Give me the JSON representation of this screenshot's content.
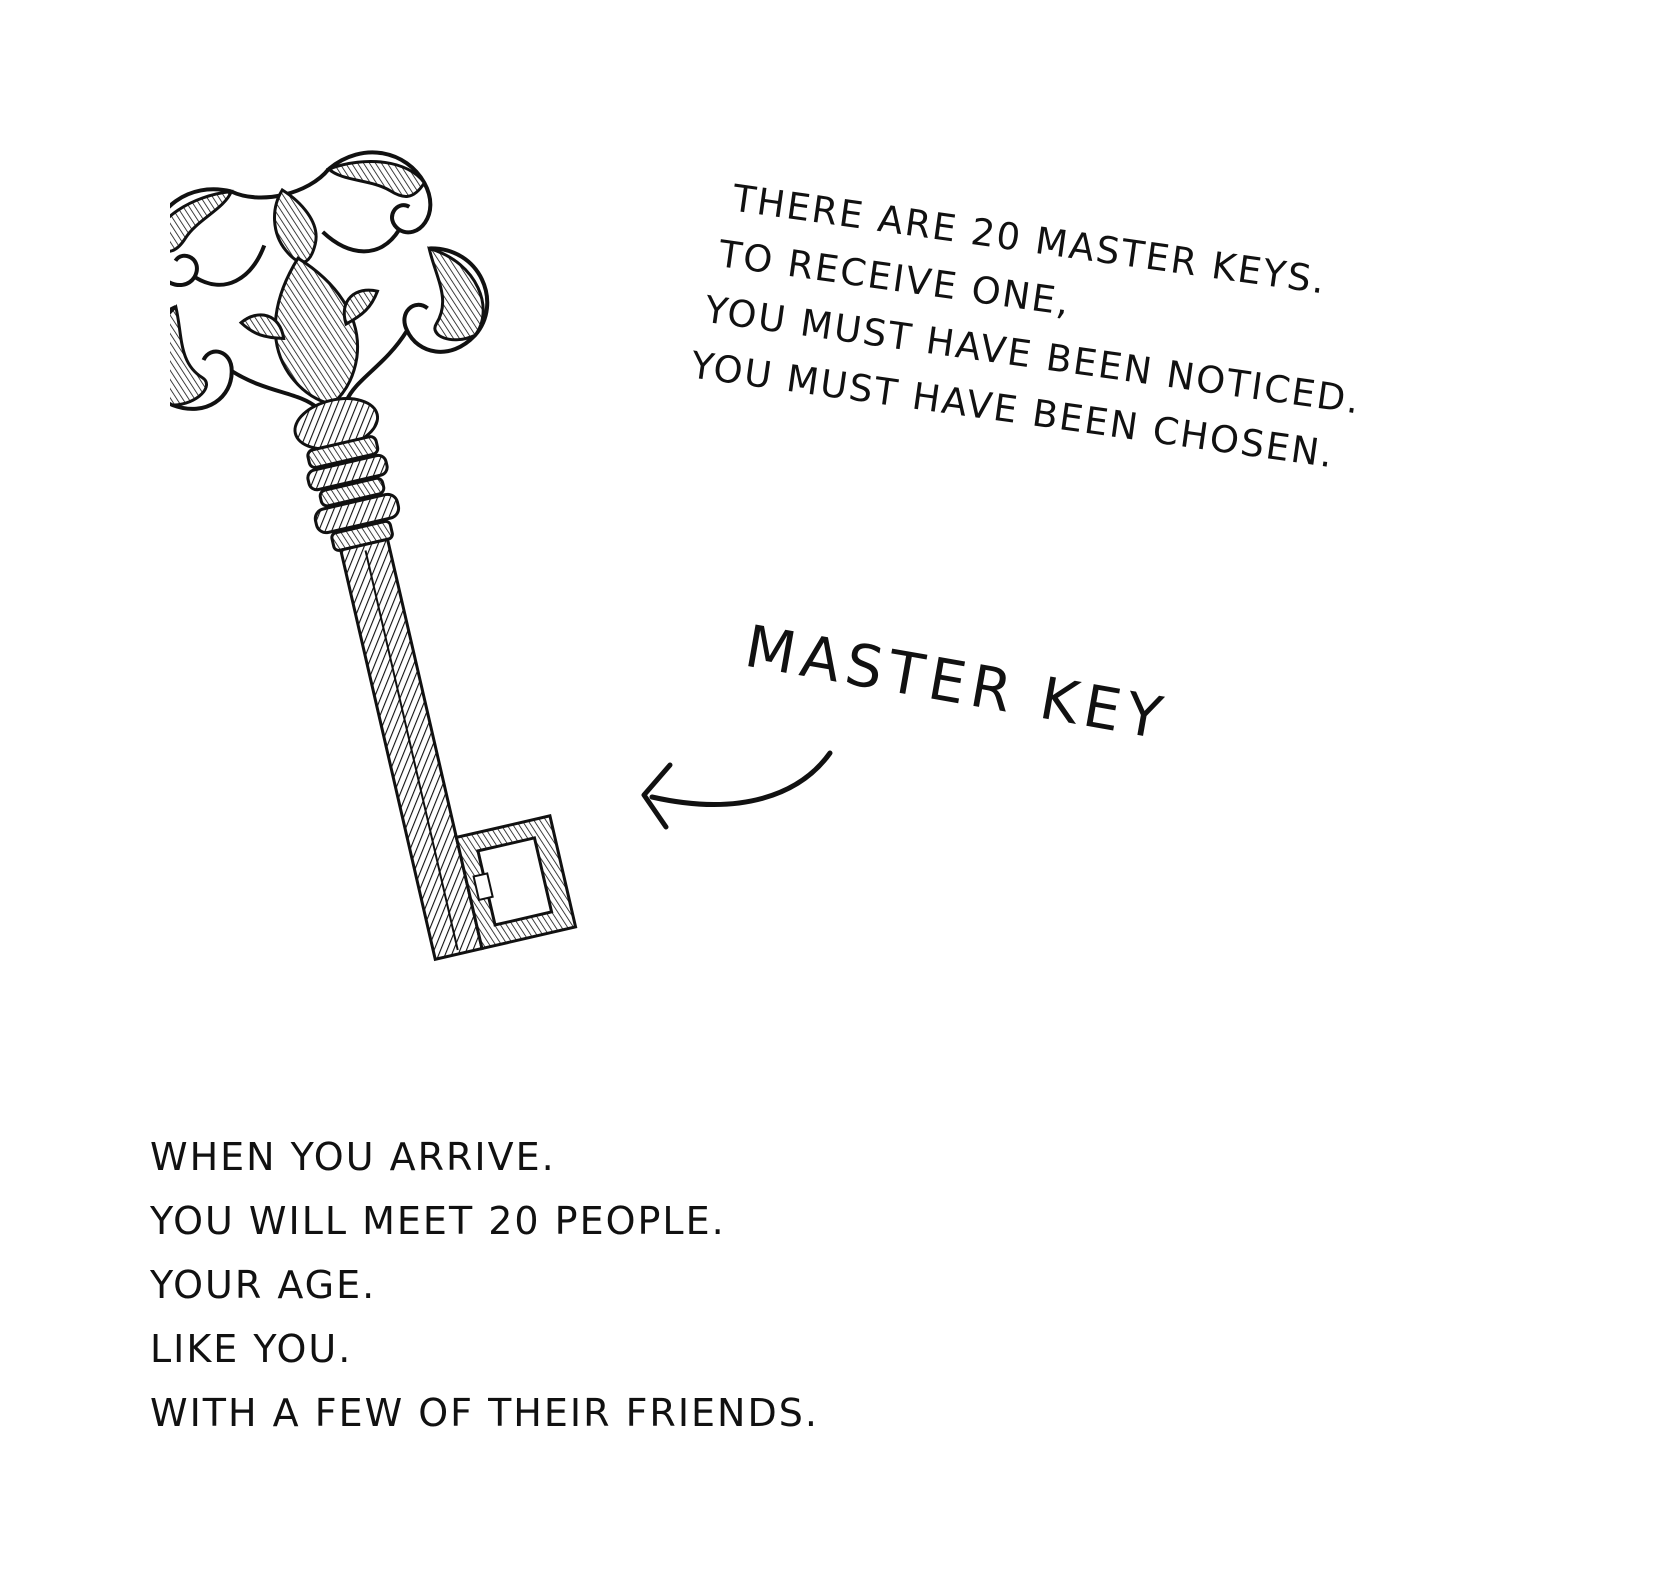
{
  "top_note": {
    "lines": [
      "THERE ARE 20 MASTER KEYS.",
      "TO RECEIVE ONE,",
      "YOU MUST HAVE BEEN NOTICED.",
      "YOU MUST HAVE BEEN CHOSEN."
    ]
  },
  "label": {
    "text": "MASTER KEY"
  },
  "bottom_note": {
    "lines": [
      "WHEN YOU ARRIVE.",
      "YOU WILL MEET 20 PEOPLE.",
      "YOUR AGE.",
      "LIKE YOU.",
      "WITH A FEW OF THEIR FRIENDS."
    ]
  },
  "illustration": {
    "icon": "ornate-key-icon",
    "arrow_icon": "curved-arrow-icon",
    "ink_color": "#111111",
    "background_color": "#ffffff"
  }
}
